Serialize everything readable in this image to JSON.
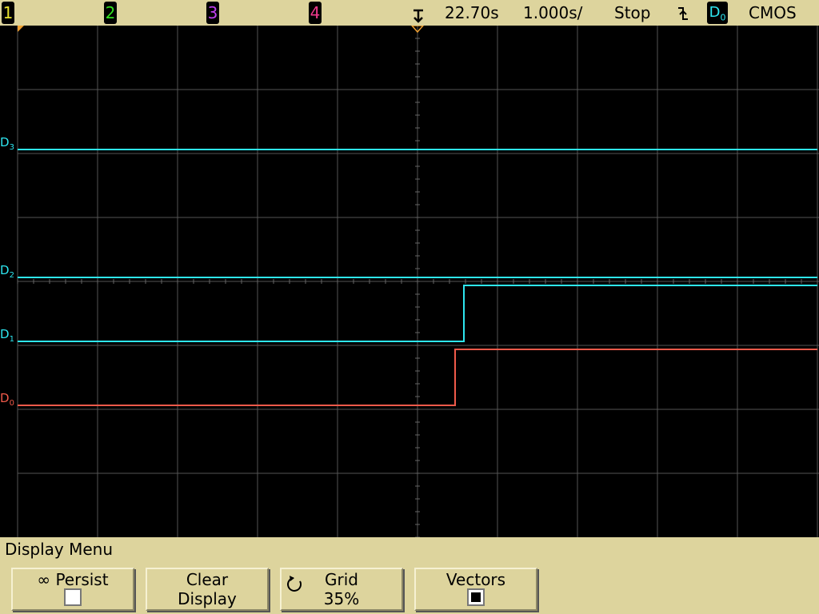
{
  "top_bar": {
    "channels": [
      {
        "label": "1",
        "color": "#e8e22e"
      },
      {
        "label": "2",
        "color": "#33e020"
      },
      {
        "label": "3",
        "color": "#c040f0"
      },
      {
        "label": "4",
        "color": "#f03a8c"
      }
    ],
    "trigger_marker_icon": "trigger-position-icon",
    "time_reference": "22.70s",
    "time_per_div": "1.000s/",
    "run_state": "Stop",
    "trigger_slope_icon": "falling-edge-icon",
    "trigger_source": "D",
    "trigger_source_sub": "0",
    "logic_family": "CMOS"
  },
  "digital_channels": [
    {
      "label": "D",
      "sub": "3",
      "color": "#2ee6f0",
      "levels": [
        {
          "from": -5,
          "to": 5,
          "level": 0
        }
      ]
    },
    {
      "label": "D",
      "sub": "2",
      "color": "#2ee6f0",
      "levels": [
        {
          "from": -5,
          "to": 5,
          "level": 0
        }
      ]
    },
    {
      "label": "D",
      "sub": "1",
      "color": "#2ee6f0",
      "levels": [
        {
          "from": -5,
          "to": 0.58,
          "level": 0
        },
        {
          "from": 0.58,
          "to": 5,
          "level": 1
        }
      ]
    },
    {
      "label": "D",
      "sub": "0",
      "color": "#f05a4a",
      "levels": [
        {
          "from": -5,
          "to": 0.47,
          "level": 0
        },
        {
          "from": 0.47,
          "to": 5,
          "level": 1
        }
      ]
    }
  ],
  "menu": {
    "title": "Display Menu",
    "softkeys": [
      {
        "icon": "infinity-icon",
        "line1": "∞ Persist",
        "line2": "",
        "checkbox": false
      },
      {
        "line1": "Clear",
        "line2": "Display"
      },
      {
        "icon": "rotate-knob-icon",
        "line1": "Grid",
        "line2": "35%"
      },
      {
        "line1": "Vectors",
        "line2": "",
        "checkbox": true
      }
    ]
  }
}
